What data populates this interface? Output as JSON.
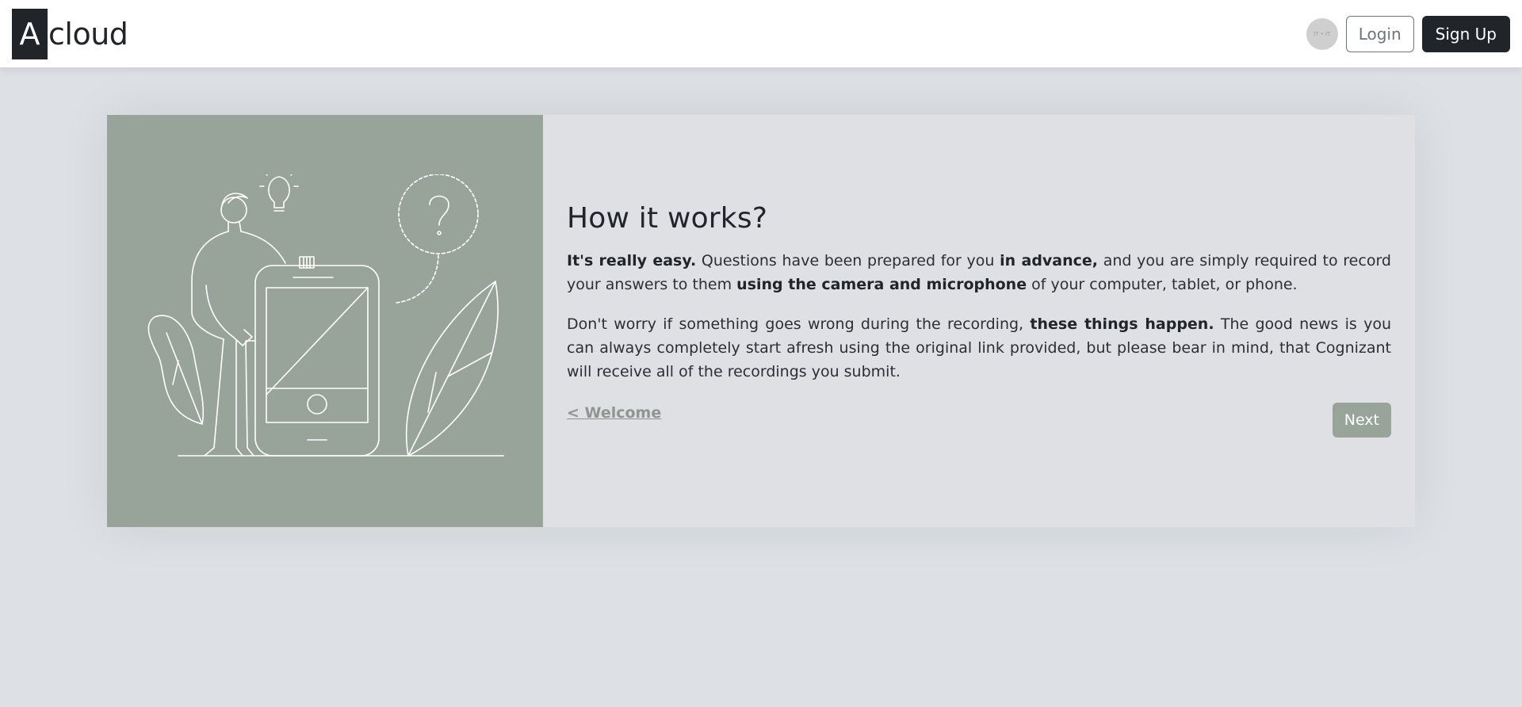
{
  "header": {
    "brand_letter": "A",
    "brand_rest": "cloud",
    "lang_badge": "IT • IT",
    "login_label": "Login",
    "signup_label": "Sign Up"
  },
  "card": {
    "title": "How it works?",
    "p1": {
      "b1": "It's really easy.",
      "t1": " Questions have been prepared for you ",
      "b2": "in advance,",
      "t2": " and you are simply required to record your answers to them ",
      "b3": "using the camera and microphone",
      "t3": " of your computer, tablet, or phone."
    },
    "p2": {
      "t1": "Don't worry if something goes wrong during the recording, ",
      "b1": "these things happen.",
      "t2": " The good news is you can always completely start afresh using the original link provided, but please bear in mind, that Cognizant will receive all of the recordings you submit."
    },
    "back_label": "< Welcome",
    "next_label": "Next"
  },
  "colors": {
    "illustration_bg": "#98a39a",
    "dark": "#212529",
    "page_bg": "#dde0e4"
  }
}
